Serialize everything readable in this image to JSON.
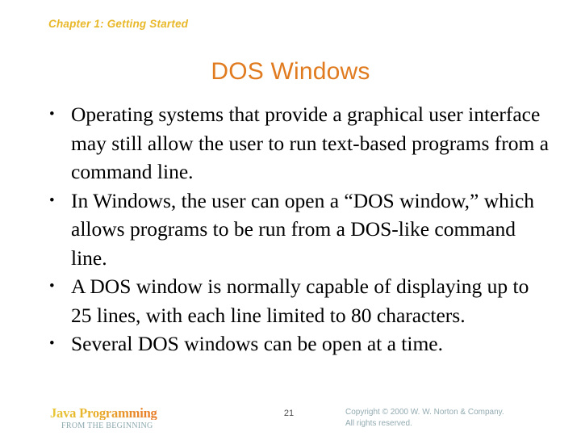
{
  "slide": {
    "chapter_header": "Chapter 1: Getting Started",
    "title": "DOS Windows",
    "bullets": [
      "Operating systems that provide a graphical user interface may still allow the user to run text-based programs from a command line.",
      "In Windows, the user can open a “DOS window,” which allows programs to be run from a DOS-like command line.",
      "A DOS window is normally capable of displaying up to 25 lines, with each line limited to 80 characters.",
      "Several DOS windows can be open at a time."
    ],
    "bullet_marker": "•"
  },
  "footer": {
    "brand_title": "Java Programming",
    "brand_subtitle": "FROM THE BEGINNING",
    "page_number": "21",
    "copyright_line_1": "Copyright © 2000 W. W. Norton & Company.",
    "copyright_line_2": "All rights reserved."
  },
  "colors": {
    "chapter_header": "#e8b828",
    "title": "#e07b20",
    "body_text": "#000000",
    "brand_gradient_start": "#e8c83a",
    "brand_gradient_end": "#e06a26",
    "brand_subtitle": "#8aa7ae",
    "copyright": "#93abb2",
    "page_number": "#4a4a4a",
    "background": "#ffffff"
  }
}
